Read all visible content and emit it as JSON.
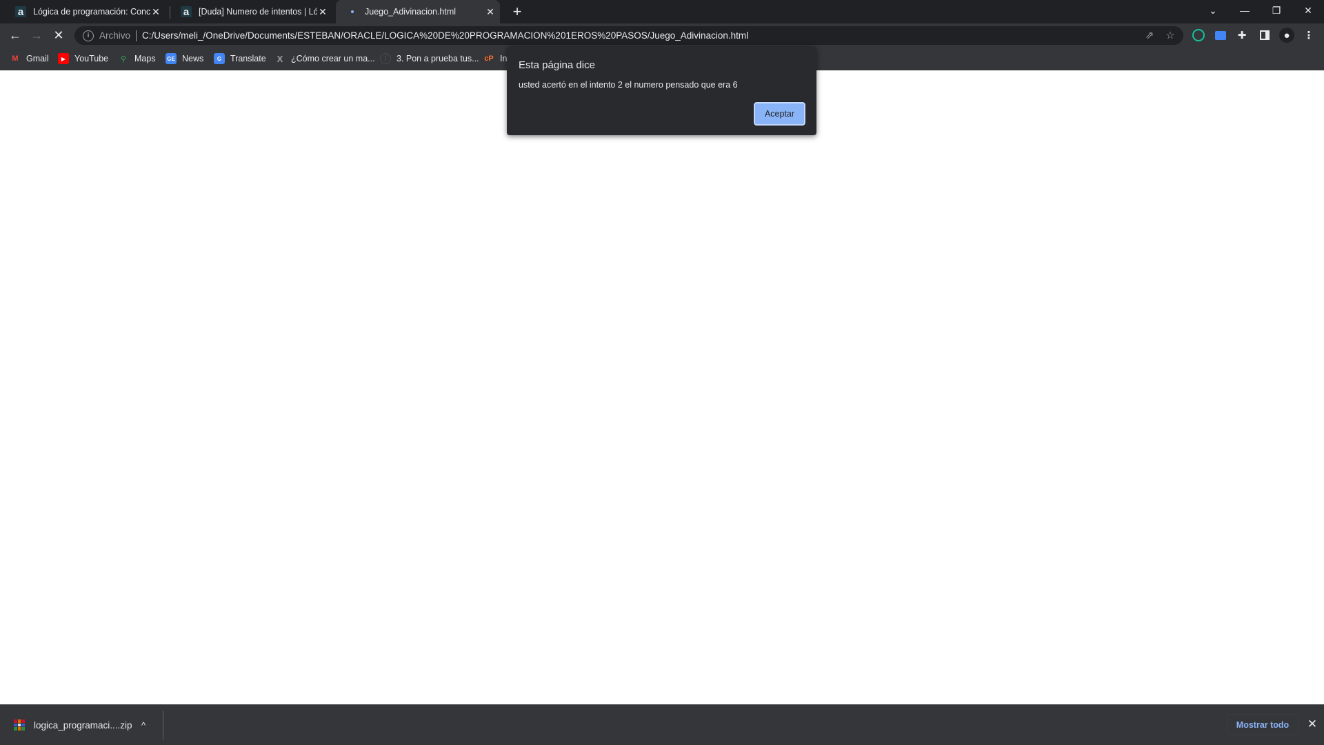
{
  "tabs": [
    {
      "title": "Lógica de programación: Concep",
      "favicon": "alura-icon",
      "active": false
    },
    {
      "title": "[Duda] Numero de intentos | Lóg",
      "favicon": "alura-icon",
      "active": false
    },
    {
      "title": "Juego_Adivinacion.html",
      "favicon": "loading-spinner-icon",
      "active": true
    }
  ],
  "tab_close_glyph": "✕",
  "new_tab_glyph": "+",
  "window_controls": {
    "tab_search": "⌄",
    "minimize": "—",
    "restore": "❐",
    "close": "✕"
  },
  "toolbar": {
    "back": "←",
    "forward": "→",
    "stop": "✕",
    "omnibox": {
      "security_label": "Archivo",
      "url": "C:/Users/meli_/OneDrive/Documents/ESTEBAN/ORACLE/LOGICA%20DE%20PROGRAMACION%201EROS%20PASOS/Juego_Adivinacion.html"
    }
  },
  "bookmarks": [
    {
      "label": "Gmail",
      "icon": "gmail-icon"
    },
    {
      "label": "YouTube",
      "icon": "youtube-icon"
    },
    {
      "label": "Maps",
      "icon": "maps-icon"
    },
    {
      "label": "News",
      "icon": "news-icon"
    },
    {
      "label": "Translate",
      "icon": "translate-icon"
    },
    {
      "label": "¿Cómo crear un ma...",
      "icon": "x-logo-icon"
    },
    {
      "label": "3. Pon a prueba tus...",
      "icon": "slash-circle-icon"
    },
    {
      "label": "In",
      "icon": "cpanel-icon"
    }
  ],
  "dialog": {
    "title": "Esta página dice",
    "message": "usted acertó en el intento 2 el numero pensado que era 6",
    "ok_label": "Aceptar"
  },
  "download_bar": {
    "file_name": "logica_programaci....zip",
    "chevron": "^",
    "show_all_label": "Mostrar todo",
    "close_glyph": "✕"
  },
  "colors": {
    "accent": "#8ab4f8",
    "frame": "#202124",
    "toolbar": "#35363a"
  }
}
